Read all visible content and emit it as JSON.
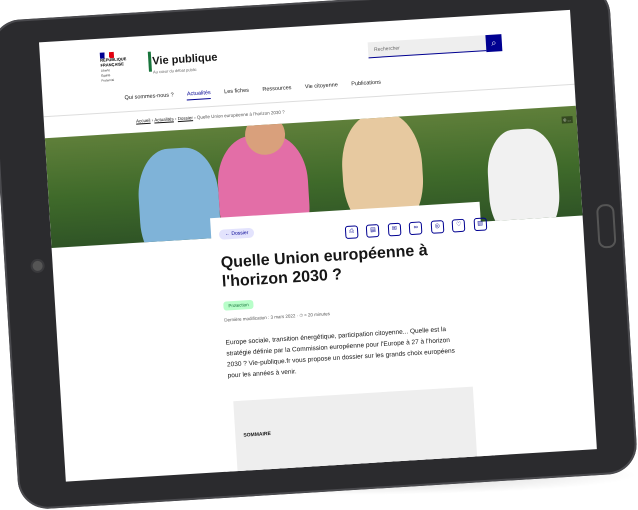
{
  "header": {
    "republic_lines": [
      "RÉPUBLIQUE",
      "FRANÇAISE"
    ],
    "republic_motto": [
      "Liberté",
      "Égalité",
      "Fraternité"
    ],
    "site_title": "Vie publique",
    "site_subtitle": "Au cœur du débat public"
  },
  "search": {
    "placeholder": "Rechercher"
  },
  "nav": {
    "items": [
      "Qui sommes-nous ?",
      "Actualités",
      "Les fiches",
      "Ressources",
      "Vie citoyenne",
      "Publications"
    ]
  },
  "breadcrumb": {
    "home": "Accueil",
    "section": "Actualités",
    "subsection": "Dossier",
    "current": "Quelle Union européenne à l'horizon 2030 ?"
  },
  "hero": {
    "caption": "© ..."
  },
  "article": {
    "tag": "← Dossier",
    "title": "Quelle Union européenne à l'horizon 2030 ?",
    "badge": "Protection",
    "meta": "Dernière modification : 3 mars 2022 · ⏱ ≈ 20 minutes",
    "intro": "Europe sociale, transition énergétique, participation citoyenne... Quelle est la stratégie définie par la Commission européenne pour l'Europe à 27 à l'horizon 2030 ? Vie-publique.fr vous propose un dossier sur les grands choix européens pour les années à venir.",
    "sommaire": "SOMMAIRE"
  },
  "tool_icons": [
    "print-icon",
    "pdf-icon",
    "mail-icon",
    "link-icon",
    "share-icon",
    "bookmark-icon",
    "download-icon"
  ]
}
